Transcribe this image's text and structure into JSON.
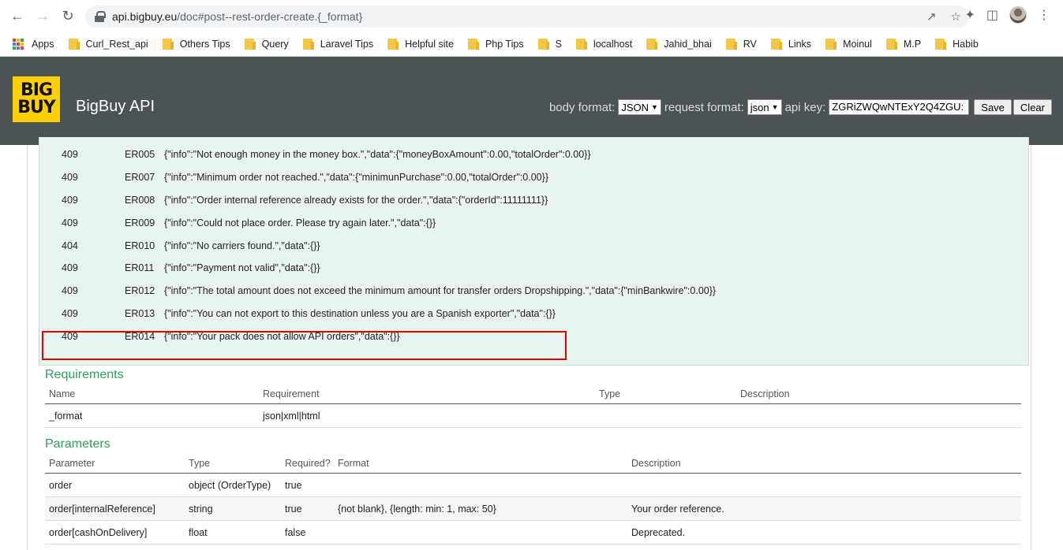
{
  "browser": {
    "url_host": "api.bigbuy.eu",
    "url_path": "/doc#post--rest-order-create.{_format}",
    "bookmarks": [
      "Apps",
      "Curl_Rest_api",
      "Others  Tips",
      "Query",
      "Laravel Tips",
      "Helpful site",
      "Php Tips",
      "S",
      "localhost",
      "Jahid_bhai",
      "RV",
      "Links",
      "Moinul",
      "M.P",
      "Habib"
    ]
  },
  "header": {
    "logo_top": "BIG",
    "logo_bottom": "BUY",
    "title": "BigBuy API",
    "body_format_label": "body format:",
    "body_format_value": "JSON",
    "request_format_label": "request format:",
    "request_format_value": "json",
    "api_key_label": "api key:",
    "api_key_value": "ZGRiZWQwNTExY2Q4ZGU:",
    "save_label": "Save",
    "clear_label": "Clear"
  },
  "errors": [
    {
      "status": "409",
      "code": "ER005",
      "message": "{\"info\":\"Not enough money in the money box.\",\"data\":{\"moneyBoxAmount\":0.00,\"totalOrder\":0.00}}"
    },
    {
      "status": "409",
      "code": "ER007",
      "message": "{\"info\":\"Minimum order not reached.\",\"data\":{\"minimunPurchase\":0.00,\"totalOrder\":0.00}}"
    },
    {
      "status": "409",
      "code": "ER008",
      "message": "{\"info\":\"Order internal reference already exists for the order.\",\"data\":{\"orderId\":11111111}}"
    },
    {
      "status": "409",
      "code": "ER009",
      "message": "{\"info\":\"Could not place order. Please try again later.\",\"data\":{}}"
    },
    {
      "status": "404",
      "code": "ER010",
      "message": "{\"info\":\"No carriers found.\",\"data\":{}}"
    },
    {
      "status": "409",
      "code": "ER011",
      "message": "{\"info\":\"Payment not valid\",\"data\":{}}"
    },
    {
      "status": "409",
      "code": "ER012",
      "message": "{\"info\":\"The total amount does not exceed the minimum amount for transfer orders Dropshipping.\",\"data\":{\"minBankwire\":0.00}}"
    },
    {
      "status": "409",
      "code": "ER013",
      "message": "{\"info\":\"You can not export to this destination unless you are a Spanish exporter\",\"data\":{}}"
    },
    {
      "status": "409",
      "code": "ER014",
      "message": "{\"info\":\"Your pack does not allow API orders\",\"data\":{}}"
    }
  ],
  "requirements": {
    "title": "Requirements",
    "headers": {
      "name": "Name",
      "requirement": "Requirement",
      "type": "Type",
      "description": "Description"
    },
    "rows": [
      {
        "name": "_format",
        "requirement": "json|xml|html",
        "type": "",
        "description": ""
      }
    ]
  },
  "parameters": {
    "title": "Parameters",
    "headers": {
      "parameter": "Parameter",
      "type": "Type",
      "required": "Required?",
      "format": "Format",
      "description": "Description"
    },
    "rows": [
      {
        "parameter": "order",
        "type": "object (OrderType)",
        "required": "true",
        "format": "",
        "description": ""
      },
      {
        "parameter": "order[internalReference]",
        "type": "string",
        "required": "true",
        "format": "{not blank}, {length: min: 1, max: 50}",
        "description": "Your order reference."
      },
      {
        "parameter": "order[cashOnDelivery]",
        "type": "float",
        "required": "false",
        "format": "",
        "description": "Deprecated."
      }
    ]
  }
}
